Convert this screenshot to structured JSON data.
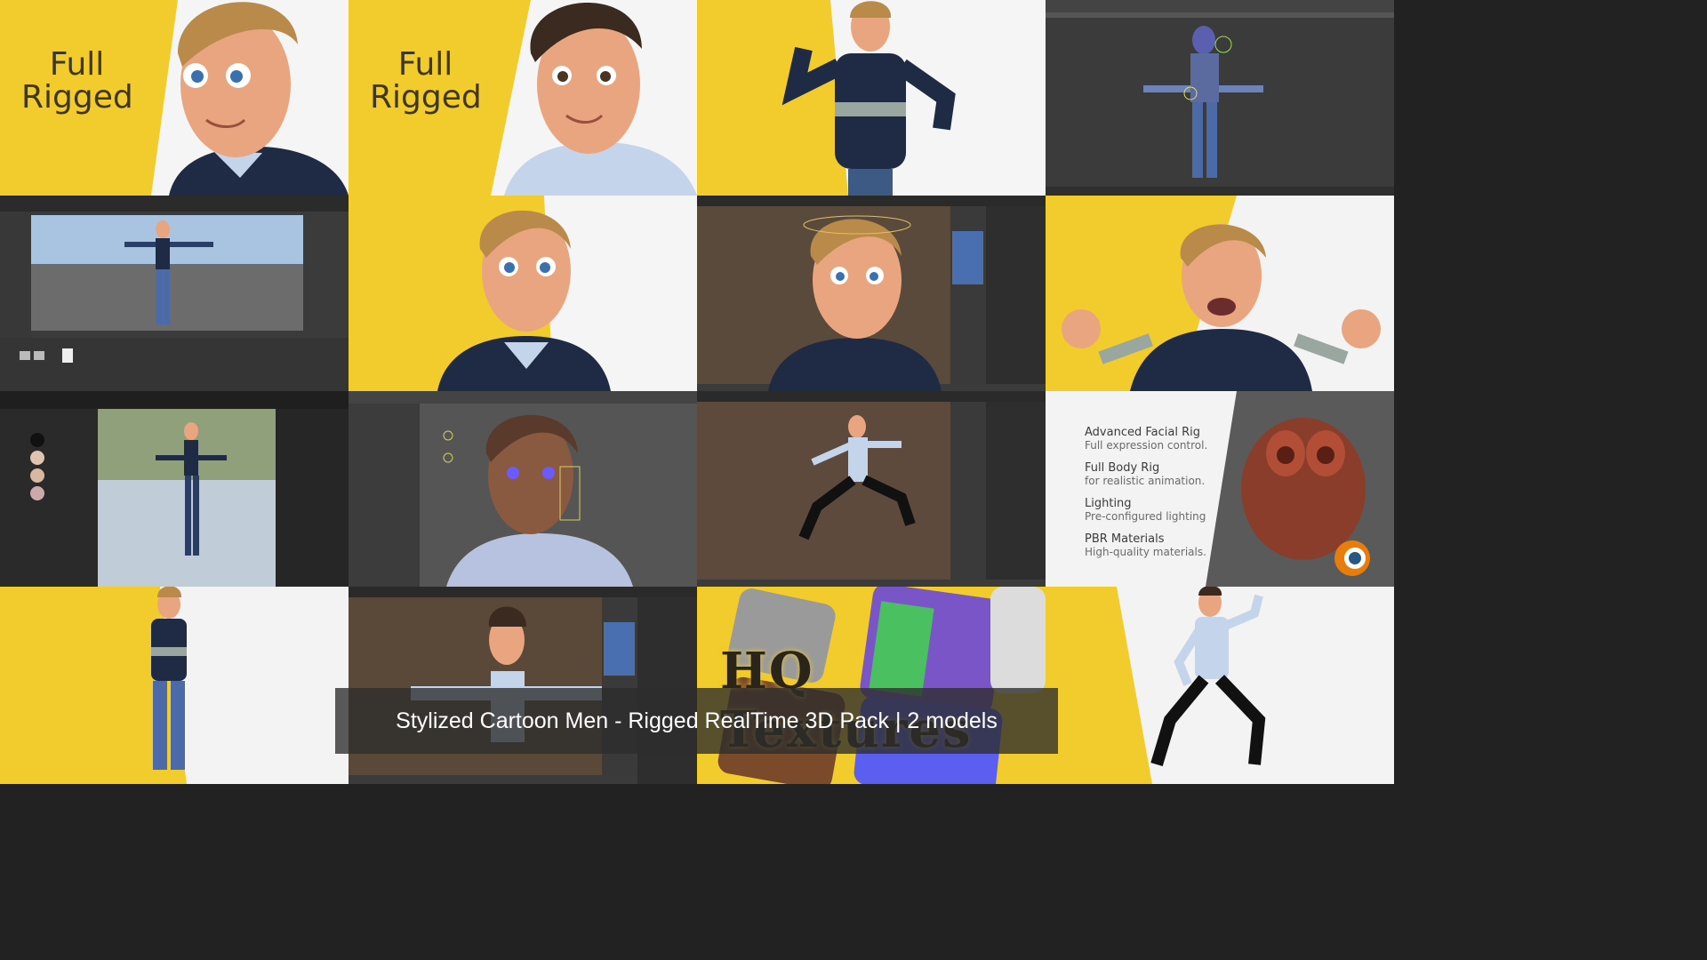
{
  "caption": "Stylized Cartoon Men - Rigged RealTime 3D Pack | 2 models",
  "promo_tiles": [
    {
      "line1": "Full",
      "line2": "Rigged"
    },
    {
      "line1": "Full",
      "line2": "Rigged"
    }
  ],
  "features": [
    {
      "title": "Advanced Facial Rig",
      "subtitle": "Full expression control."
    },
    {
      "title": "Full Body Rig",
      "subtitle": "for realistic animation."
    },
    {
      "title": "Lighting",
      "subtitle": "Pre-configured lighting"
    },
    {
      "title": "PBR Materials",
      "subtitle": "High-quality materials."
    }
  ],
  "textures_title": "HQ Textures",
  "colors": {
    "brand_yellow": "#f2cb2c",
    "skin": "#e9a57f",
    "hair": "#b98a4a",
    "sweater": "#1f2a45",
    "shirt": "#c4d4ea",
    "blender_orange": "#e87d0d",
    "blender_blue": "#265787"
  }
}
